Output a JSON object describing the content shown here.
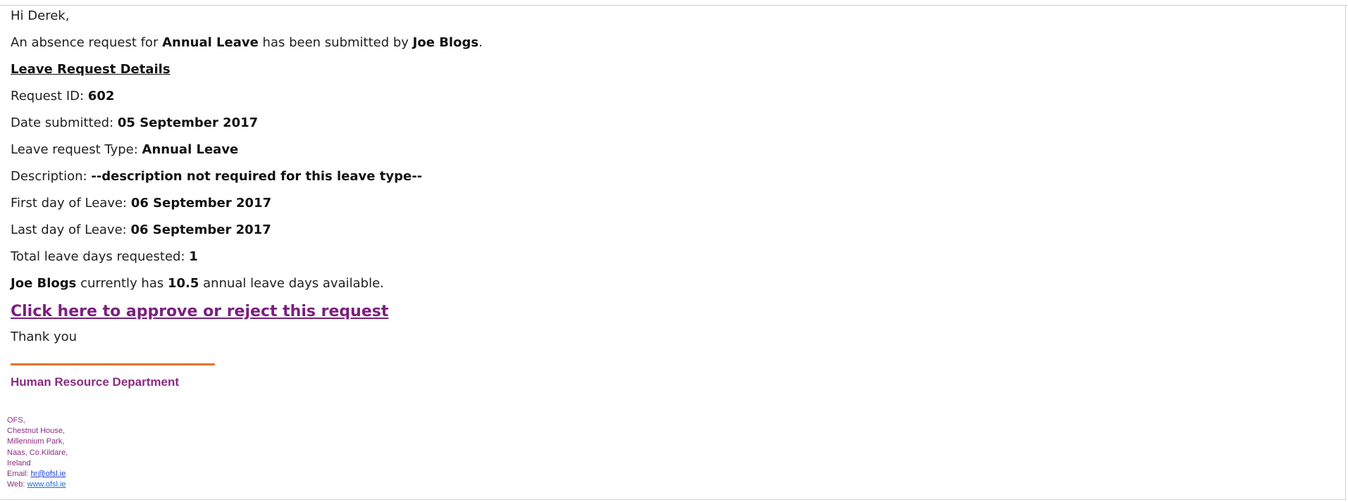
{
  "greeting": "Hi Derek,",
  "intro": {
    "prefix": "An absence request for ",
    "leave_type": "Annual Leave",
    "middle": " has been submitted by ",
    "employee": "Joe Blogs",
    "suffix": "."
  },
  "details_heading": "Leave Request Details",
  "details": [
    {
      "label": "Request ID: ",
      "value": "602"
    },
    {
      "label": "Date submitted: ",
      "value": "05 September 2017"
    },
    {
      "label": "Leave request Type: ",
      "value": "Annual Leave"
    },
    {
      "label": "Description: ",
      "value": "--description not required for this leave type--"
    },
    {
      "label": "First day of Leave: ",
      "value": "06 September 2017"
    },
    {
      "label": "Last day of Leave: ",
      "value": "06 September 2017"
    },
    {
      "label": "Total leave days requested: ",
      "value": "1"
    }
  ],
  "balance": {
    "employee": "Joe Blogs",
    "middle": " currently has ",
    "days": "10.5",
    "suffix": " annual leave days available."
  },
  "approve_link": "Click here to approve or reject this request",
  "thanks": "Thank you",
  "signature": {
    "department": "Human Resource Department",
    "address_lines": [
      "OFS,",
      "Chestnut House,",
      "Millennium Park,",
      "Naas, Co.Kildare,",
      "Ireland"
    ],
    "email_label": "Email: ",
    "email": "hr@ofsl.ie",
    "web_label": "Web: ",
    "web": "www.ofsl.ie"
  },
  "colors": {
    "link": "#7b1f7f",
    "signature": "#8a2b82",
    "rule": "#e8742a"
  }
}
